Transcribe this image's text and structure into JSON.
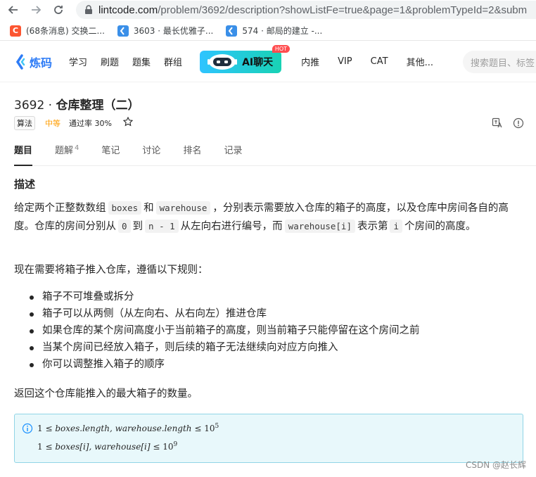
{
  "browser": {
    "url_host": "lintcode.com",
    "url_path": "/problem/3692/description?showListFe=true&page=1&problemTypeId=2&subm"
  },
  "bookmarks": [
    {
      "icon": "csdn-logo-icon",
      "label": "(68条消息) 交换二..."
    },
    {
      "icon": "lintcode-logo-icon",
      "label": "3603 · 最长优雅子..."
    },
    {
      "icon": "lintcode-logo-icon",
      "label": "574 · 邮局的建立 -..."
    }
  ],
  "header": {
    "logo_text": "炼码",
    "nav": [
      "学习",
      "刷题",
      "题集",
      "群组"
    ],
    "ai_label": "AI聊天",
    "hot_badge": "HOT",
    "nav_right": [
      "内推",
      "VIP",
      "CAT",
      "其他..."
    ],
    "search_placeholder": "搜索题目、标签"
  },
  "problem": {
    "number": "3692 · ",
    "name": "仓库整理（二）",
    "tag": "算法",
    "difficulty": "中等",
    "pass_rate": "通过率 30%",
    "tabs": [
      {
        "label": "题目",
        "sup": ""
      },
      {
        "label": "题解",
        "sup": "4"
      },
      {
        "label": "笔记",
        "sup": ""
      },
      {
        "label": "讨论",
        "sup": ""
      },
      {
        "label": "排名",
        "sup": ""
      },
      {
        "label": "记录",
        "sup": ""
      }
    ]
  },
  "description": {
    "heading": "描述",
    "p1": {
      "t1": "给定两个正整数数组",
      "c1": "boxes",
      "t2": "和",
      "c2": "warehouse",
      "t3": "，分别表示需要放入仓库的箱子的高度，以及仓库中房间各自的高度。仓库的房间分别从",
      "c3": "0",
      "t4": "到",
      "c4": "n - 1",
      "t5": "从左向右进行编号，而",
      "c5": "warehouse[i]",
      "t6": "表示第",
      "c6": "i",
      "t7": "个房间的高度。"
    },
    "p2": "现在需要将箱子推入仓库，遵循以下规则：",
    "rules": [
      "箱子不可堆叠或拆分",
      "箱子可以从两侧（从左向右、从右向左）推进仓库",
      "如果仓库的某个房间高度小于当前箱子的高度，则当前箱子只能停留在这个房间之前",
      "当某个房间已经放入箱子，则后续的箱子无法继续向对应方向推入",
      "你可以调整推入箱子的顺序"
    ],
    "p3": "返回这个仓库能推入的最大箱子的数量。"
  },
  "constraints": {
    "line1": {
      "lhs": "1",
      "rel": " ≤ ",
      "expr": "boxes.length, warehouse.length",
      "rel2": " ≤ ",
      "base": "10",
      "exp": "5"
    },
    "line2": {
      "lhs": "1",
      "rel": " ≤ ",
      "expr": "boxes[i], warehouse[i]",
      "rel2": " ≤ ",
      "base": "10",
      "exp": "9"
    }
  },
  "watermark": "CSDN @赵长辉",
  "colors": {
    "accent": "#2e7cf6",
    "difficulty": "#ff9d00",
    "note_bg": "#e8f8fb",
    "note_border": "#91d5e6"
  }
}
